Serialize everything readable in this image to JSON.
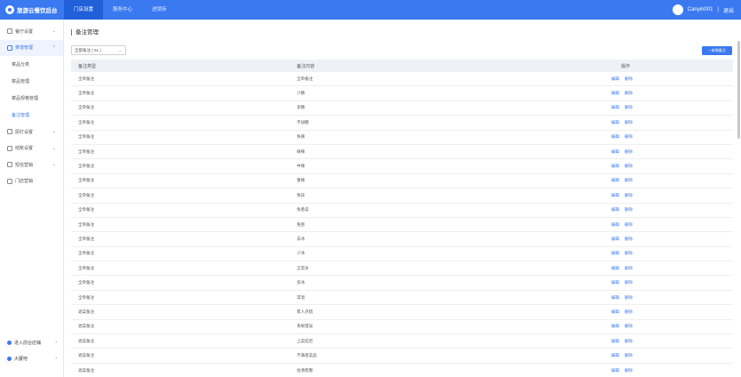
{
  "brand": {
    "name": "旅游云餐饮后台"
  },
  "topnav": [
    {
      "label": "门店设置",
      "active": true
    },
    {
      "label": "服务中心",
      "active": false
    },
    {
      "label": "进销存",
      "active": false
    }
  ],
  "user": {
    "name": "Canyin001",
    "separator": "|",
    "logout": "退出"
  },
  "sidebar": {
    "groups": [
      {
        "label": "餐厅设置",
        "icon": "home-icon",
        "chevron": "⌄"
      },
      {
        "label": "菜谱管理",
        "icon": "menu-book-icon",
        "chevron": "⌃",
        "open": true
      }
    ],
    "subitems": [
      {
        "label": "菜品分类",
        "active": false
      },
      {
        "label": "菜品管理",
        "active": false
      },
      {
        "label": "菜品规格管理",
        "active": false
      },
      {
        "label": "备注管理",
        "active": true
      }
    ],
    "groups2": [
      {
        "label": "厨打设置",
        "icon": "printer-icon",
        "chevron": "⌄"
      },
      {
        "label": "结账设置",
        "icon": "checkout-icon",
        "chevron": "⌄"
      },
      {
        "label": "短信营销",
        "icon": "sms-icon",
        "chevron": "⌄"
      },
      {
        "label": "门店营销",
        "icon": "marketing-icon",
        "chevron": ""
      }
    ],
    "bottom": [
      {
        "label": "进入前台店铺",
        "chevron": "›"
      },
      {
        "label": "大厦吧",
        "chevron": "›"
      }
    ]
  },
  "page": {
    "title": "备注管理"
  },
  "filter": {
    "value": "全部备注 ( 91 )"
  },
  "add_button": {
    "label": "+ 新增备注"
  },
  "table": {
    "headers": [
      "备注类型",
      "备注内容",
      "操作"
    ],
    "actions": [
      "编辑",
      "删除"
    ],
    "rows": [
      [
        "全单备注",
        "全单备注"
      ],
      [
        "全单备注",
        "少糖"
      ],
      [
        "全单备注",
        "多糖"
      ],
      [
        "全单备注",
        "不加糖"
      ],
      [
        "全单备注",
        "免辣"
      ],
      [
        "全单备注",
        "微辣"
      ],
      [
        "全单备注",
        "中辣"
      ],
      [
        "全单备注",
        "重辣"
      ],
      [
        "全单备注",
        "免蒜"
      ],
      [
        "全单备注",
        "免香菜"
      ],
      [
        "全单备注",
        "免葱"
      ],
      [
        "全单备注",
        "去冰"
      ],
      [
        "全单备注",
        "少冰"
      ],
      [
        "全单备注",
        "正常冰"
      ],
      [
        "全单备注",
        "多冰"
      ],
      [
        "全单备注",
        "常温"
      ],
      [
        "退菜备注",
        "客人点错"
      ],
      [
        "退菜备注",
        "系统错误"
      ],
      [
        "退菜备注",
        "上菜延迟"
      ],
      [
        "退菜备注",
        "不满意菜品"
      ],
      [
        "退菜备注",
        "估清售罄"
      ]
    ]
  }
}
